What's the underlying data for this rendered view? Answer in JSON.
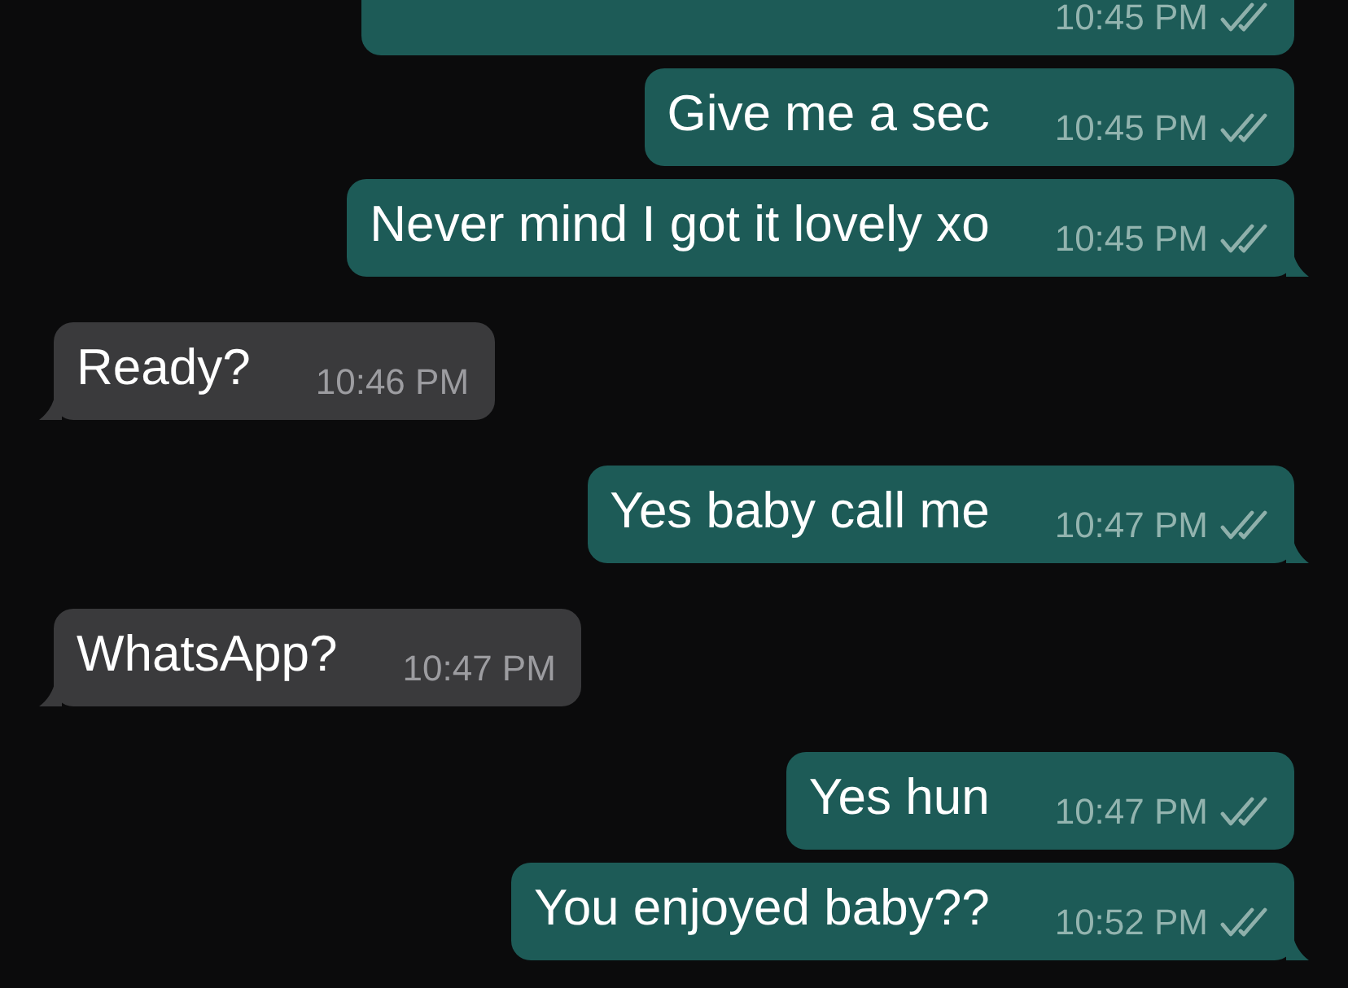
{
  "messages": [
    {
      "kind": "sent",
      "time": "10:45 PM",
      "read": false
    },
    {
      "kind": "sent",
      "text": "Give me a sec",
      "time": "10:45 PM",
      "read": false
    },
    {
      "kind": "sent",
      "text": "Never mind I got it lovely xo",
      "time": "10:45 PM",
      "read": false
    },
    {
      "kind": "received",
      "text": "Ready?",
      "time": "10:46 PM"
    },
    {
      "kind": "sent",
      "text": "Yes baby call me",
      "time": "10:47 PM",
      "read": false
    },
    {
      "kind": "received",
      "text": "WhatsApp?",
      "time": "10:47 PM"
    },
    {
      "kind": "sent",
      "text": "Yes hun",
      "time": "10:47 PM",
      "read": false
    },
    {
      "kind": "sent",
      "text": "You enjoyed baby??",
      "time": "10:52 PM",
      "read": false
    }
  ]
}
